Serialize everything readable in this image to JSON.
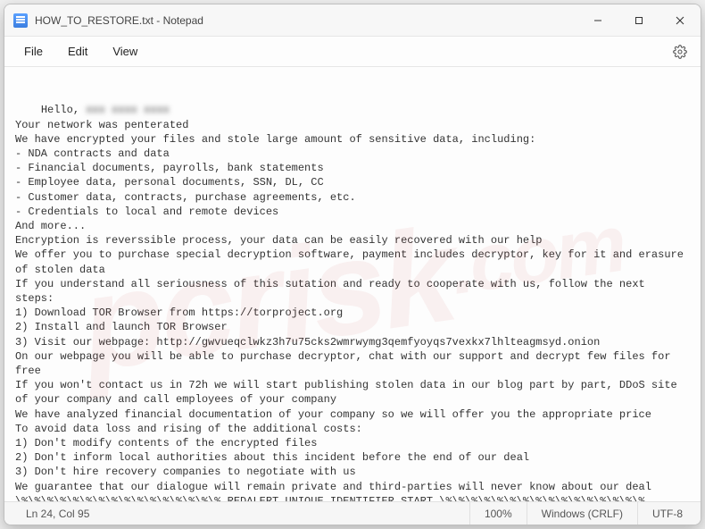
{
  "title": "HOW_TO_RESTORE.txt - Notepad",
  "menu": {
    "file": "File",
    "edit": "Edit",
    "view": "View"
  },
  "body": {
    "hello_prefix": "Hello, ",
    "hello_blurred": "xxx xxxx xxxx",
    "lines": "Your network was penterated\nWe have encrypted your files and stole large amount of sensitive data, including:\n- NDA contracts and data\n- Financial documents, payrolls, bank statements\n- Employee data, personal documents, SSN, DL, CC\n- Customer data, contracts, purchase agreements, etc.\n- Credentials to local and remote devices\nAnd more...\nEncryption is reverssible process, your data can be easily recovered with our help\nWe offer you to purchase special decryption software, payment includes decryptor, key for it and erasure of stolen data\nIf you understand all seriousness of this sutation and ready to cooperate with us, follow the next steps:\n1) Download TOR Browser from https://torproject.org\n2) Install and launch TOR Browser\n3) Visit our webpage: http://gwvueqclwkz3h7u75cks2wmrwymg3qemfyoyqs7vexkx7lhlteagmsyd.onion\nOn our webpage you will be able to purchase decryptor, chat with our support and decrypt few files for free\nIf you won't contact us in 72h we will start publishing stolen data in our blog part by part, DDoS site of your company and call employees of your company\nWe have analyzed financial documentation of your company so we will offer you the appropriate price\nTo avoid data loss and rising of the additional costs:\n1) Don't modify contents of the encrypted files\n2) Don't inform local authorities about this incident before the end of our deal\n3) Don't hire recovery companies to negotiate with us\nWe guarantee that our dialogue will remain private and third-parties will never know about our deal\n\\%\\%\\%\\%\\%\\%\\%\\%\\%\\%\\%\\%\\%\\%\\%\\% REDALERT UNIQUE IDENTIFIER START \\%\\%\\%\\%\\%\\%\\%\\%\\%\\%\\%\\%\\%\\%\\%\\%"
  },
  "status": {
    "pos": "Ln 24, Col 95",
    "zoom": "100%",
    "eol": "Windows (CRLF)",
    "enc": "UTF-8"
  },
  "watermark": {
    "main": "pcrisk",
    "suffix": ".com"
  }
}
